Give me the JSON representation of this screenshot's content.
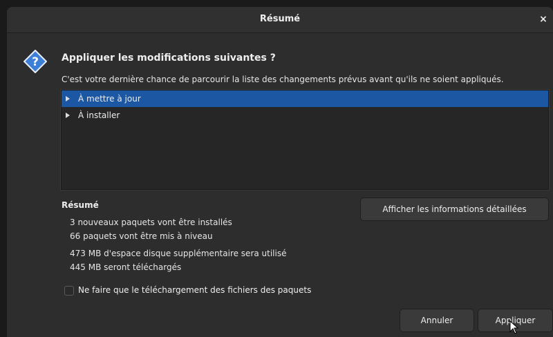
{
  "window": {
    "title": "Résumé",
    "close_glyph": "×"
  },
  "dialog": {
    "icon": "question-icon",
    "heading": "Appliquer les modifications suivantes ?",
    "subtext": "C'est votre dernière chance de parcourir la liste des changements prévus avant qu'ils ne soient appliqués."
  },
  "changes_tree": {
    "items": [
      {
        "label": "À mettre à jour",
        "selected": true
      },
      {
        "label": "À installer",
        "selected": false
      }
    ]
  },
  "summary": {
    "label": "Résumé",
    "details_button": "Afficher les informations détaillées",
    "lines": [
      "3 nouveaux paquets vont être installés",
      "66 paquets vont être mis à niveau",
      "473 MB d'espace disque supplémentaire sera utilisé",
      "445 MB seront téléchargés"
    ]
  },
  "download_only": {
    "label": "Ne faire que le téléchargement des fichiers des paquets",
    "checked": false
  },
  "buttons": {
    "cancel": "Annuler",
    "apply": "Appliquer"
  },
  "colors": {
    "selection": "#1c57a4",
    "window_bg": "#2d2d2d",
    "icon_blue": "#3d7fd6"
  }
}
